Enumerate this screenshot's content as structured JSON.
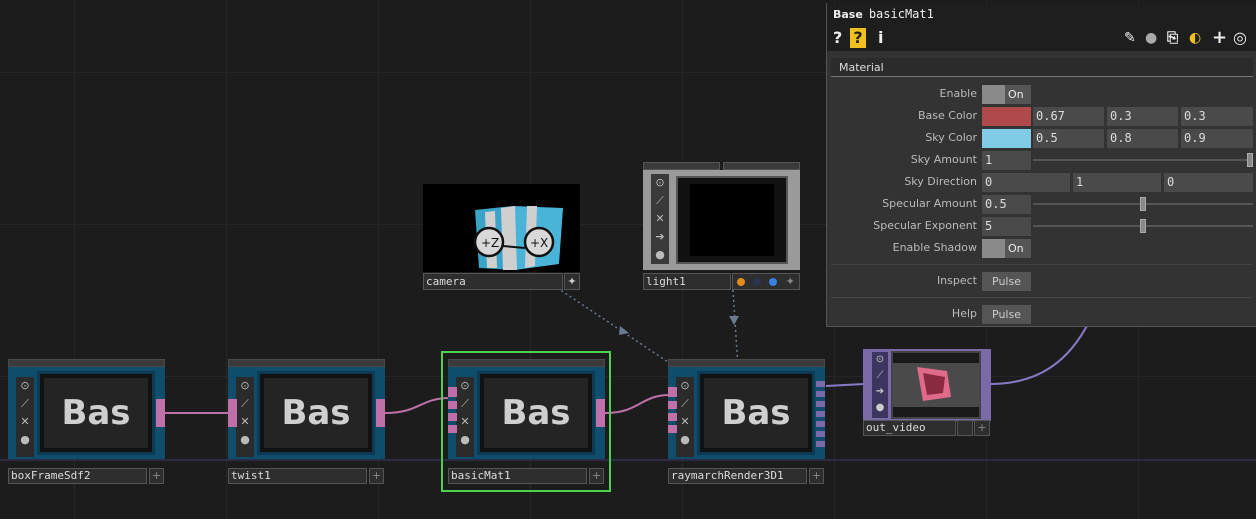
{
  "nodes": {
    "box_frame": {
      "label": "boxFrameSdf2",
      "preview": "Bas"
    },
    "twist": {
      "label": "twist1",
      "preview": "Bas"
    },
    "basic_mat": {
      "label": "basicMat1",
      "preview": "Bas"
    },
    "raymarch": {
      "label": "raymarchRender3D1",
      "preview": "Bas"
    },
    "camera": {
      "label": "camera",
      "face_z": "+Z",
      "face_x": "+X"
    },
    "light": {
      "label": "light1"
    },
    "out_video": {
      "label": "out_video"
    }
  },
  "panel": {
    "type": "Base",
    "name": "basicMat1",
    "tab": "Material",
    "enable": {
      "label": "Enable",
      "value": "On"
    },
    "base_color": {
      "label": "Base Color",
      "r": "0.67",
      "g": "0.3",
      "b": "0.3",
      "swatch": "#b04a4a"
    },
    "sky_color": {
      "label": "Sky Color",
      "r": "0.5",
      "g": "0.8",
      "b": "0.9",
      "swatch": "#80cce6"
    },
    "sky_amount": {
      "label": "Sky Amount",
      "value": "1",
      "fraction": 1.0
    },
    "sky_direction": {
      "label": "Sky Direction",
      "x": "0",
      "y": "1",
      "z": "0"
    },
    "specular_amount": {
      "label": "Specular Amount",
      "value": "0.5",
      "fraction": 0.5
    },
    "specular_exponent": {
      "label": "Specular Exponent",
      "value": "5",
      "fraction": 0.5
    },
    "enable_shadow": {
      "label": "Enable Shadow",
      "value": "On"
    },
    "inspect": {
      "label": "Inspect",
      "button": "Pulse"
    },
    "help": {
      "label": "Help",
      "button": "Pulse"
    }
  },
  "colors": {
    "node_teal": "#0e4d6b",
    "selection": "#4bd34b",
    "wire_pink": "#c070a8",
    "wire_purple": "#7a6aa8"
  }
}
